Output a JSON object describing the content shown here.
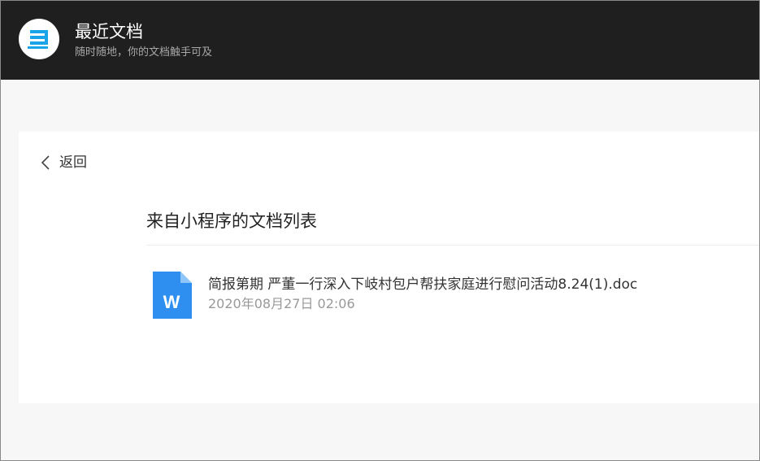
{
  "header": {
    "title": "最近文档",
    "subtitle": "随时随地，你的文档触手可及",
    "logo_icon": "document-stack-icon",
    "logo_color": "#1aa3e8",
    "background": "#1f1f1f"
  },
  "nav": {
    "back_label": "返回",
    "back_icon": "chevron-left-icon"
  },
  "list": {
    "title": "来自小程序的文档列表",
    "items": [
      {
        "name": "简报第期 严董一行深入下岐村包户帮扶家庭进行慰问活动8.24(1).doc",
        "date": "2020年08月27日 02:06",
        "icon": "word-document-icon",
        "icon_letter": "W",
        "icon_color": "#2f8ff0"
      }
    ]
  }
}
